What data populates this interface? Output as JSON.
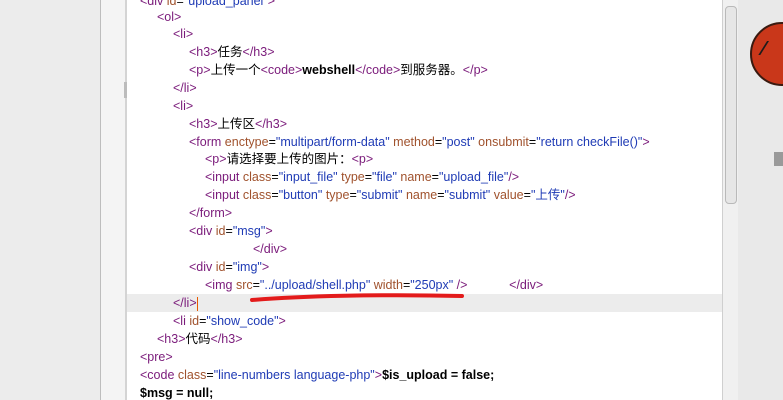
{
  "code_lines": [
    {
      "id": "l0",
      "html": "<span class=\"tag\">&lt;div</span> <span class=\"attr\">id</span>=<span class=\"val\">\"upload_panel\"</span><span class=\"tag\">&gt;</span>"
    },
    {
      "id": "l1",
      "html": "<span class=\"tag\">&lt;ol&gt;</span>"
    },
    {
      "id": "l2",
      "html": "<span class=\"tag\">&lt;li&gt;</span>"
    },
    {
      "id": "l3",
      "html": "<span class=\"tag\">&lt;h3&gt;</span><span class=\"txt\">任务</span><span class=\"tag\">&lt;/h3&gt;</span>"
    },
    {
      "id": "l4",
      "html": "<span class=\"tag\">&lt;p&gt;</span><span class=\"txt\">上传一个</span><span class=\"tag\">&lt;code&gt;</span><span class=\"txt bold\">webshell</span><span class=\"tag\">&lt;/code&gt;</span><span class=\"txt\">到服务器。</span><span class=\"tag\">&lt;/p&gt;</span>"
    },
    {
      "id": "l5",
      "html": "<span class=\"tag\">&lt;/li&gt;</span>"
    },
    {
      "id": "l6",
      "html": "<span class=\"tag\">&lt;li&gt;</span>"
    },
    {
      "id": "l7",
      "html": "<span class=\"tag\">&lt;h3&gt;</span><span class=\"txt\">上传区</span><span class=\"tag\">&lt;/h3&gt;</span>"
    },
    {
      "id": "l8",
      "html": "<span class=\"tag\">&lt;form</span> <span class=\"attr\">enctype</span>=<span class=\"val\">\"multipart/form-data\"</span> <span class=\"attr\">method</span>=<span class=\"val\">\"post\"</span> <span class=\"attr\">onsubmit</span>=<span class=\"val\">\"return checkFile()\"</span><span class=\"tag\">&gt;</span>"
    },
    {
      "id": "l9",
      "html": "<span class=\"tag\">&lt;p&gt;</span><span class=\"txt\">请选择要上传的图片：</span><span class=\"tag\">&lt;p&gt;</span>"
    },
    {
      "id": "l10",
      "html": "<span class=\"tag\">&lt;input</span> <span class=\"attr\">class</span>=<span class=\"val\">\"input_file\"</span> <span class=\"attr\">type</span>=<span class=\"val\">\"file\"</span> <span class=\"attr\">name</span>=<span class=\"val\">\"upload_file\"</span><span class=\"tag\">/&gt;</span>"
    },
    {
      "id": "l11",
      "html": "<span class=\"tag\">&lt;input</span> <span class=\"attr\">class</span>=<span class=\"val\">\"button\"</span> <span class=\"attr\">type</span>=<span class=\"val\">\"submit\"</span> <span class=\"attr\">name</span>=<span class=\"val\">\"submit\"</span> <span class=\"attr\">value</span>=<span class=\"val\">\"上传\"</span><span class=\"tag\">/&gt;</span>"
    },
    {
      "id": "l12",
      "html": "<span class=\"tag\">&lt;/form&gt;</span>"
    },
    {
      "id": "l13",
      "html": "<span class=\"tag\">&lt;div</span> <span class=\"attr\">id</span>=<span class=\"val\">\"msg\"</span><span class=\"tag\">&gt;</span>"
    },
    {
      "id": "l14",
      "html": "<span class=\"tag\">&lt;/div&gt;</span>"
    },
    {
      "id": "l15",
      "html": "<span class=\"tag\">&lt;div</span> <span class=\"attr\">id</span>=<span class=\"val\">\"img\"</span><span class=\"tag\">&gt;</span>"
    },
    {
      "id": "l16",
      "html": "<span class=\"tag\">&lt;img</span> <span class=\"attr\">src</span>=<span class=\"val\">\"../upload/shell.php\"</span> <span class=\"attr\">width</span>=<span class=\"val\">\"250px\"</span> <span class=\"tag\">/&gt;</span>            <span class=\"tag\">&lt;/div&gt;</span>"
    },
    {
      "id": "l17",
      "html": "<span class=\"tag\">&lt;/li&gt;</span><span class=\"caret\"></span>"
    },
    {
      "id": "l18",
      "html": "<span class=\"tag\">&lt;li</span> <span class=\"attr\">id</span>=<span class=\"val\">\"show_code\"</span><span class=\"tag\">&gt;</span>"
    },
    {
      "id": "l19",
      "html": "<span class=\"tag\">&lt;h3&gt;</span><span class=\"txt\">代码</span><span class=\"tag\">&lt;/h3&gt;</span>"
    },
    {
      "id": "l20",
      "html": "<span class=\"tag\">&lt;pre&gt;</span>"
    },
    {
      "id": "l21",
      "html": "<span class=\"tag\">&lt;code</span> <span class=\"attr\">class</span>=<span class=\"val\">\"line-numbers language-php\"</span><span class=\"tag\">&gt;</span><span class=\"txt bold\">$is_upload = false;</span>"
    },
    {
      "id": "l22",
      "html": "<span class=\"txt bold\">$msg = null;</span>"
    }
  ],
  "colors": {
    "annotation_red": "#e31b1b",
    "caret": "#e85a00"
  },
  "icons": {
    "avatar": "avatar-icon"
  }
}
